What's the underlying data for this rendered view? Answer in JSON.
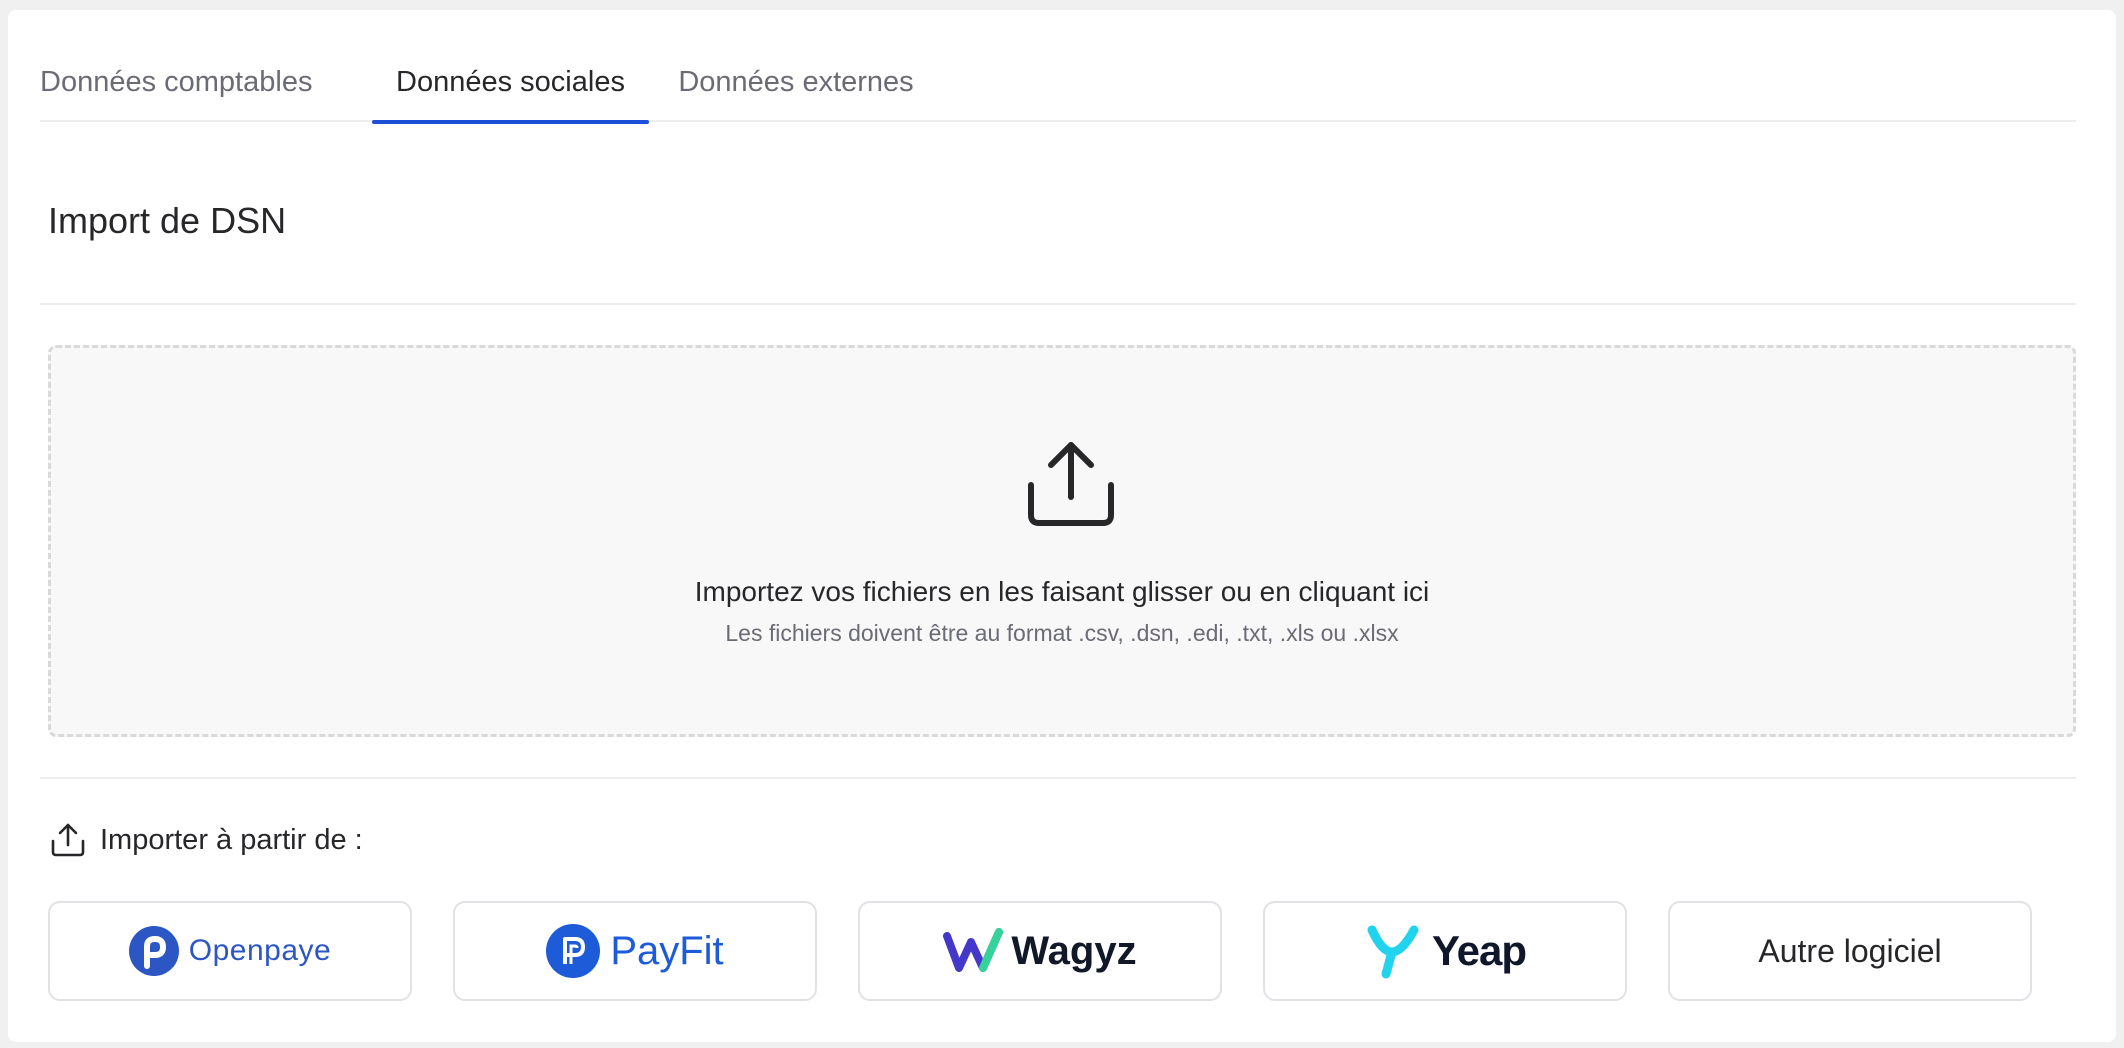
{
  "tabs": [
    {
      "label": "Données comptables",
      "active": false
    },
    {
      "label": "Données sociales",
      "active": true
    },
    {
      "label": "Données externes",
      "active": false
    }
  ],
  "section": {
    "title": "Import de DSN"
  },
  "dropzone": {
    "icon": "upload-icon",
    "main_text": "Importez vos fichiers en les faisant glisser ou en cliquant ici",
    "sub_text": "Les fichiers doivent être au format .csv, .dsn, .edi, .txt, .xls ou .xlsx"
  },
  "import_from": {
    "icon": "upload-icon",
    "label": "Importer à partir de :"
  },
  "providers": [
    {
      "name": "Openpaye",
      "icon": "openpaye-logo"
    },
    {
      "name": "PayFit",
      "icon": "payfit-logo"
    },
    {
      "name": "Wagyz",
      "icon": "wagyz-logo"
    },
    {
      "name": "Yeap",
      "icon": "yeap-logo"
    },
    {
      "name": "Autre logiciel"
    }
  ],
  "colors": {
    "accent": "#1d4ed8",
    "text": "#27272a",
    "muted": "#6b6b76",
    "border": "#e2e2e6"
  }
}
